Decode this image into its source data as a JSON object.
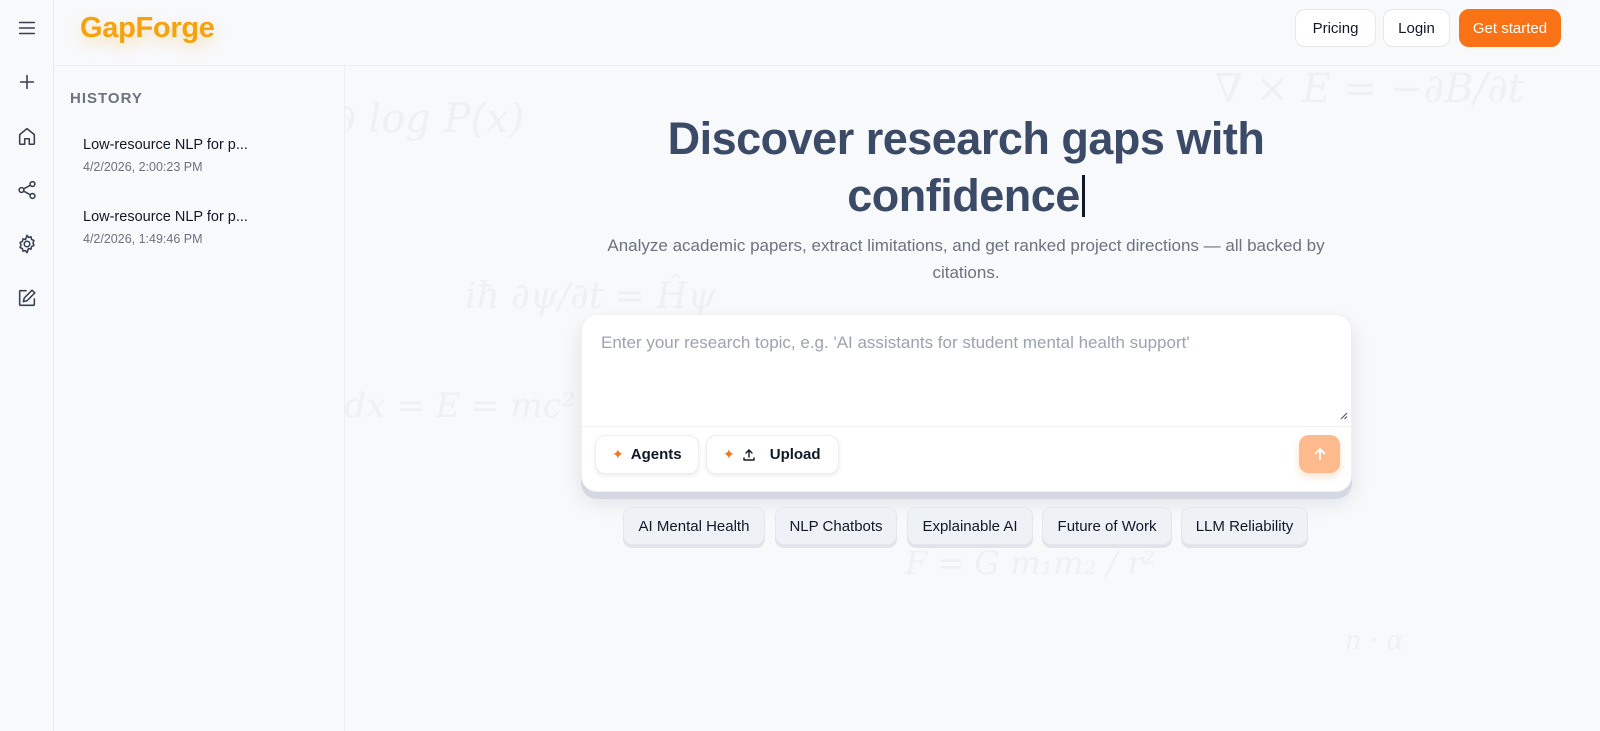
{
  "app": {
    "logo": "GapForge"
  },
  "rail": {
    "icons": [
      "menu-icon",
      "plus-icon",
      "home-icon",
      "share-icon",
      "gear-icon",
      "edit-icon"
    ]
  },
  "header": {
    "pricing_label": "Pricing",
    "login_label": "Login",
    "get_started_label": "Get started"
  },
  "history": {
    "title": "HISTORY",
    "items": [
      {
        "title": "Low-resource NLP for p...",
        "date": "4/2/2026, 2:00:23 PM"
      },
      {
        "title": "Low-resource NLP for p...",
        "date": "4/2/2026, 1:49:46 PM"
      }
    ]
  },
  "hero": {
    "title_line1": "Discover research gaps with",
    "title_line2": "confidence",
    "subtitle": "Analyze academic papers, extract limitations, and get ranked project directions — all backed by citations."
  },
  "composer": {
    "placeholder": "Enter your research topic, e.g. 'AI assistants for student mental health support'",
    "value": "",
    "agents_label": "Agents",
    "upload_label": "Upload"
  },
  "suggestions": [
    "AI Mental Health",
    "NLP Chatbots",
    "Explainable AI",
    "Future of Work",
    "LLM Reliability"
  ],
  "colors": {
    "accent": "#f97316",
    "logo": "#f5a20b",
    "title": "#3b4a66"
  }
}
